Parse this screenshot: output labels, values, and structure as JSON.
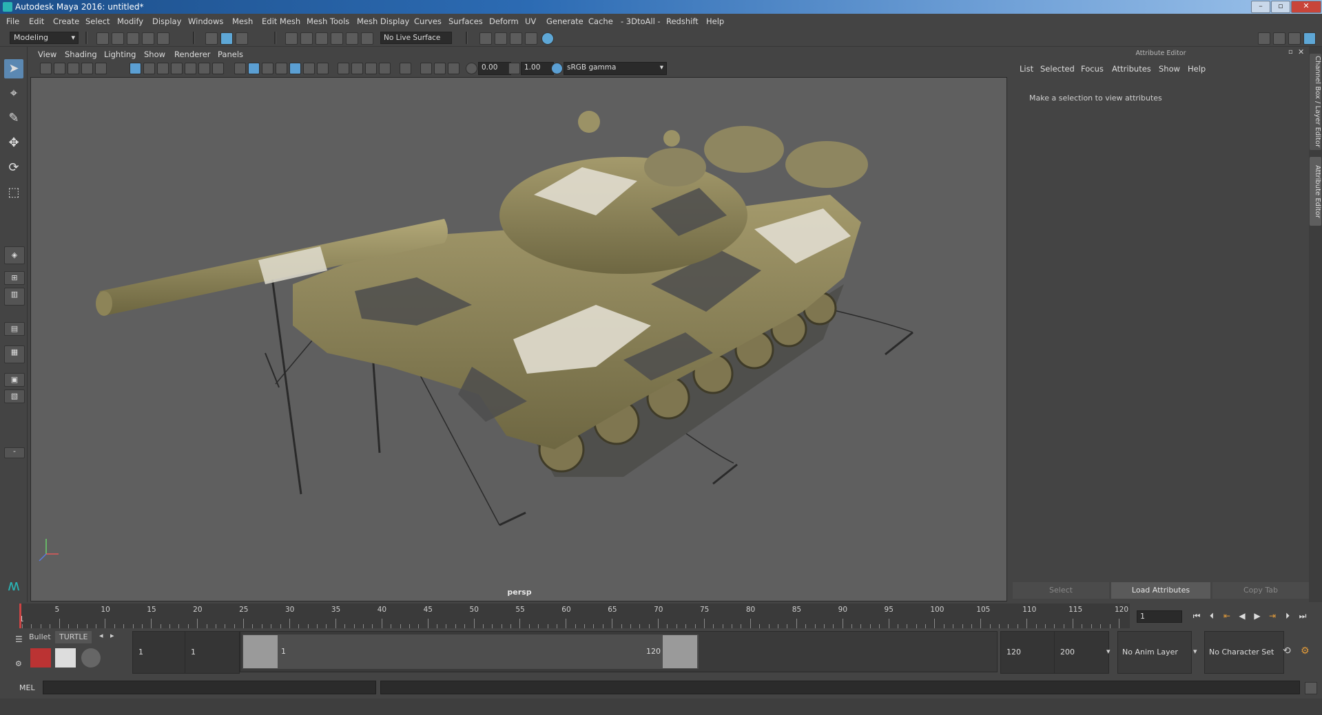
{
  "window": {
    "title": "Autodesk Maya 2016: untitled*"
  },
  "menubar": [
    "File",
    "Edit",
    "Create",
    "Select",
    "Modify",
    "Display",
    "Windows",
    "Mesh",
    "Edit Mesh",
    "Mesh Tools",
    "Mesh Display",
    "Curves",
    "Surfaces",
    "Deform",
    "UV",
    "Generate",
    "Cache",
    "- 3DtoAll -",
    "Redshift",
    "Help"
  ],
  "statusline": {
    "mode": "Modeling",
    "live_surface": "No Live Surface"
  },
  "viewport": {
    "menu": [
      "View",
      "Shading",
      "Lighting",
      "Show",
      "Renderer",
      "Panels"
    ],
    "exposure": "0.00",
    "gamma": "1.00",
    "color_space": "sRGB gamma",
    "camera_label": "persp"
  },
  "attribute_editor": {
    "title": "Attribute Editor",
    "menu": [
      "List",
      "Selected",
      "Focus",
      "Attributes",
      "Show",
      "Help"
    ],
    "message": "Make a selection to view attributes",
    "buttons": {
      "select": "Select",
      "load": "Load Attributes",
      "copy": "Copy Tab"
    },
    "side_tabs": [
      "Channel Box / Layer Editor",
      "Attribute Editor"
    ]
  },
  "timeline": {
    "start_label": "1",
    "ticks": [
      "5",
      "10",
      "15",
      "20",
      "25",
      "30",
      "35",
      "40",
      "45",
      "50",
      "55",
      "60",
      "65",
      "70",
      "75",
      "80",
      "85",
      "90",
      "95",
      "100",
      "105",
      "110",
      "115",
      "120"
    ],
    "current_frame": "1"
  },
  "range": {
    "shelf_tabs": [
      "Bullet",
      "TURTLE"
    ],
    "start": "1",
    "playback_start": "1",
    "range_start_label": "1",
    "range_end_label": "120",
    "playback_end": "120",
    "end": "200",
    "anim_layer": "No Anim Layer",
    "character_set": "No Character Set"
  },
  "commandline": {
    "language": "MEL"
  }
}
